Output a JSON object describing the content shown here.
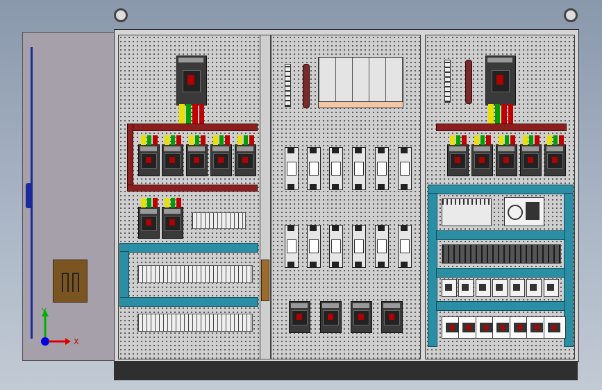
{
  "view": {
    "background_color": "#9aa6b8",
    "cabinet_color": "#d6d6d6",
    "busbar_color": "#8b1e1e",
    "wire_duct_color": "#2a8ea5",
    "triad": {
      "x_label": "X",
      "y_label": "Y",
      "x_color": "#e00000",
      "y_color": "#00b000",
      "z_color": "#0000e0"
    }
  },
  "cabinet": {
    "sections": [
      "left-section",
      "middle-section",
      "right-section"
    ],
    "left_section": {
      "main_breakers": 1,
      "busbar_breakers": 5,
      "lower_breakers": 2,
      "terminal_rows": 2
    },
    "middle_section": {
      "fuse_rows": 2,
      "fuses_per_row": 6,
      "bottom_breakers": 4
    },
    "right_section": {
      "main_breakers": 1,
      "busbar_breakers": 5,
      "relay_rows": 2,
      "relays_per_row": 7
    }
  }
}
